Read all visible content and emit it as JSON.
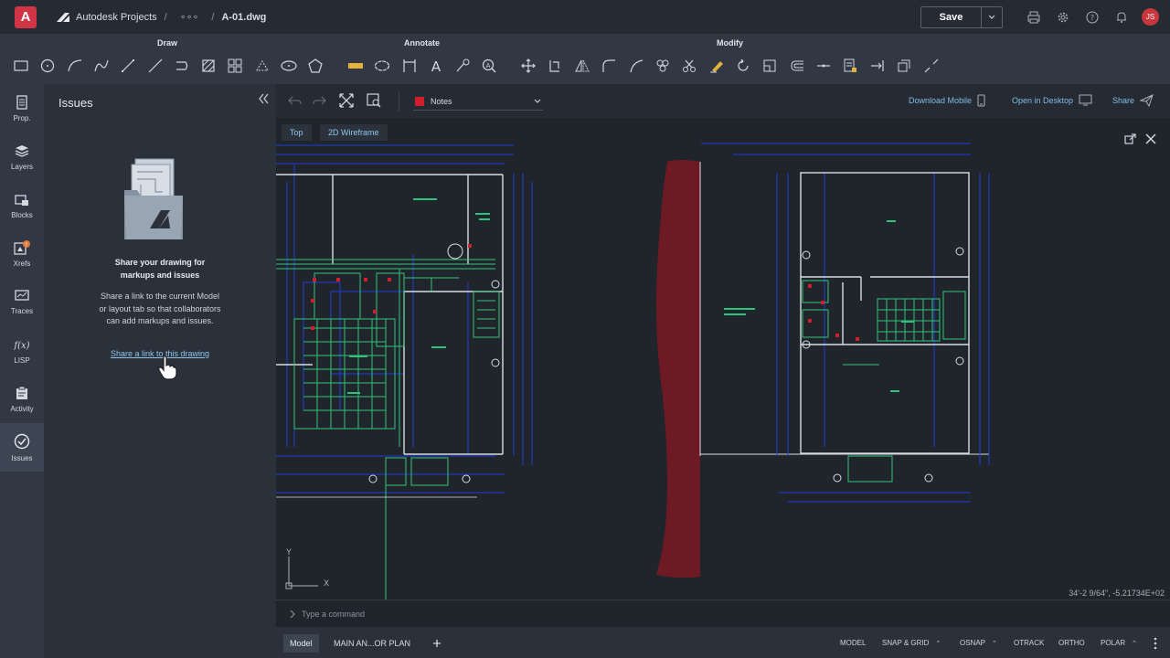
{
  "topbar": {
    "app_logo": "A",
    "breadcrumb": [
      "Autodesk Projects",
      "∘∘∘",
      "A-01.dwg"
    ],
    "save_label": "Save",
    "avatar_initials": "JS"
  },
  "ribbon": {
    "groups": [
      "Draw",
      "Annotate",
      "Modify"
    ]
  },
  "sidebar": {
    "items": [
      {
        "label": "Prop.",
        "icon": "properties-icon"
      },
      {
        "label": "Layers",
        "icon": "layers-icon"
      },
      {
        "label": "Blocks",
        "icon": "blocks-icon"
      },
      {
        "label": "Xrefs",
        "icon": "xrefs-icon"
      },
      {
        "label": "Traces",
        "icon": "traces-icon"
      },
      {
        "label": "LISP",
        "icon": "lisp-icon"
      },
      {
        "label": "Activity",
        "icon": "activity-icon"
      },
      {
        "label": "Issues",
        "icon": "issues-icon"
      }
    ],
    "xrefs_badge": "!"
  },
  "issues_panel": {
    "title": "Issues",
    "empty_heading": "Share your drawing for markups and issues",
    "empty_description": "Share a link to the current Model or layout tab so that collaborators can add markups and issues.",
    "share_link": "Share a link to this drawing"
  },
  "viewer_toolbar": {
    "layer_name": "Notes",
    "layer_color": "#d01e2c",
    "download_mobile": "Download Mobile",
    "open_in_desktop": "Open in Desktop",
    "share": "Share"
  },
  "canvas": {
    "view_top": "Top",
    "view_style": "2D Wireframe",
    "coordinates": "34'-2 9/64\", -5.21734E+02",
    "ucs_x": "X",
    "ucs_y": "Y"
  },
  "command_line": {
    "placeholder": "Type a command"
  },
  "status_bar": {
    "tabs": [
      "Model",
      "MAIN AN...OR PLAN"
    ],
    "toggles": [
      "MODEL",
      "SNAP & GRID",
      "OSNAP",
      "OTRACK",
      "ORTHO",
      "POLAR"
    ]
  }
}
